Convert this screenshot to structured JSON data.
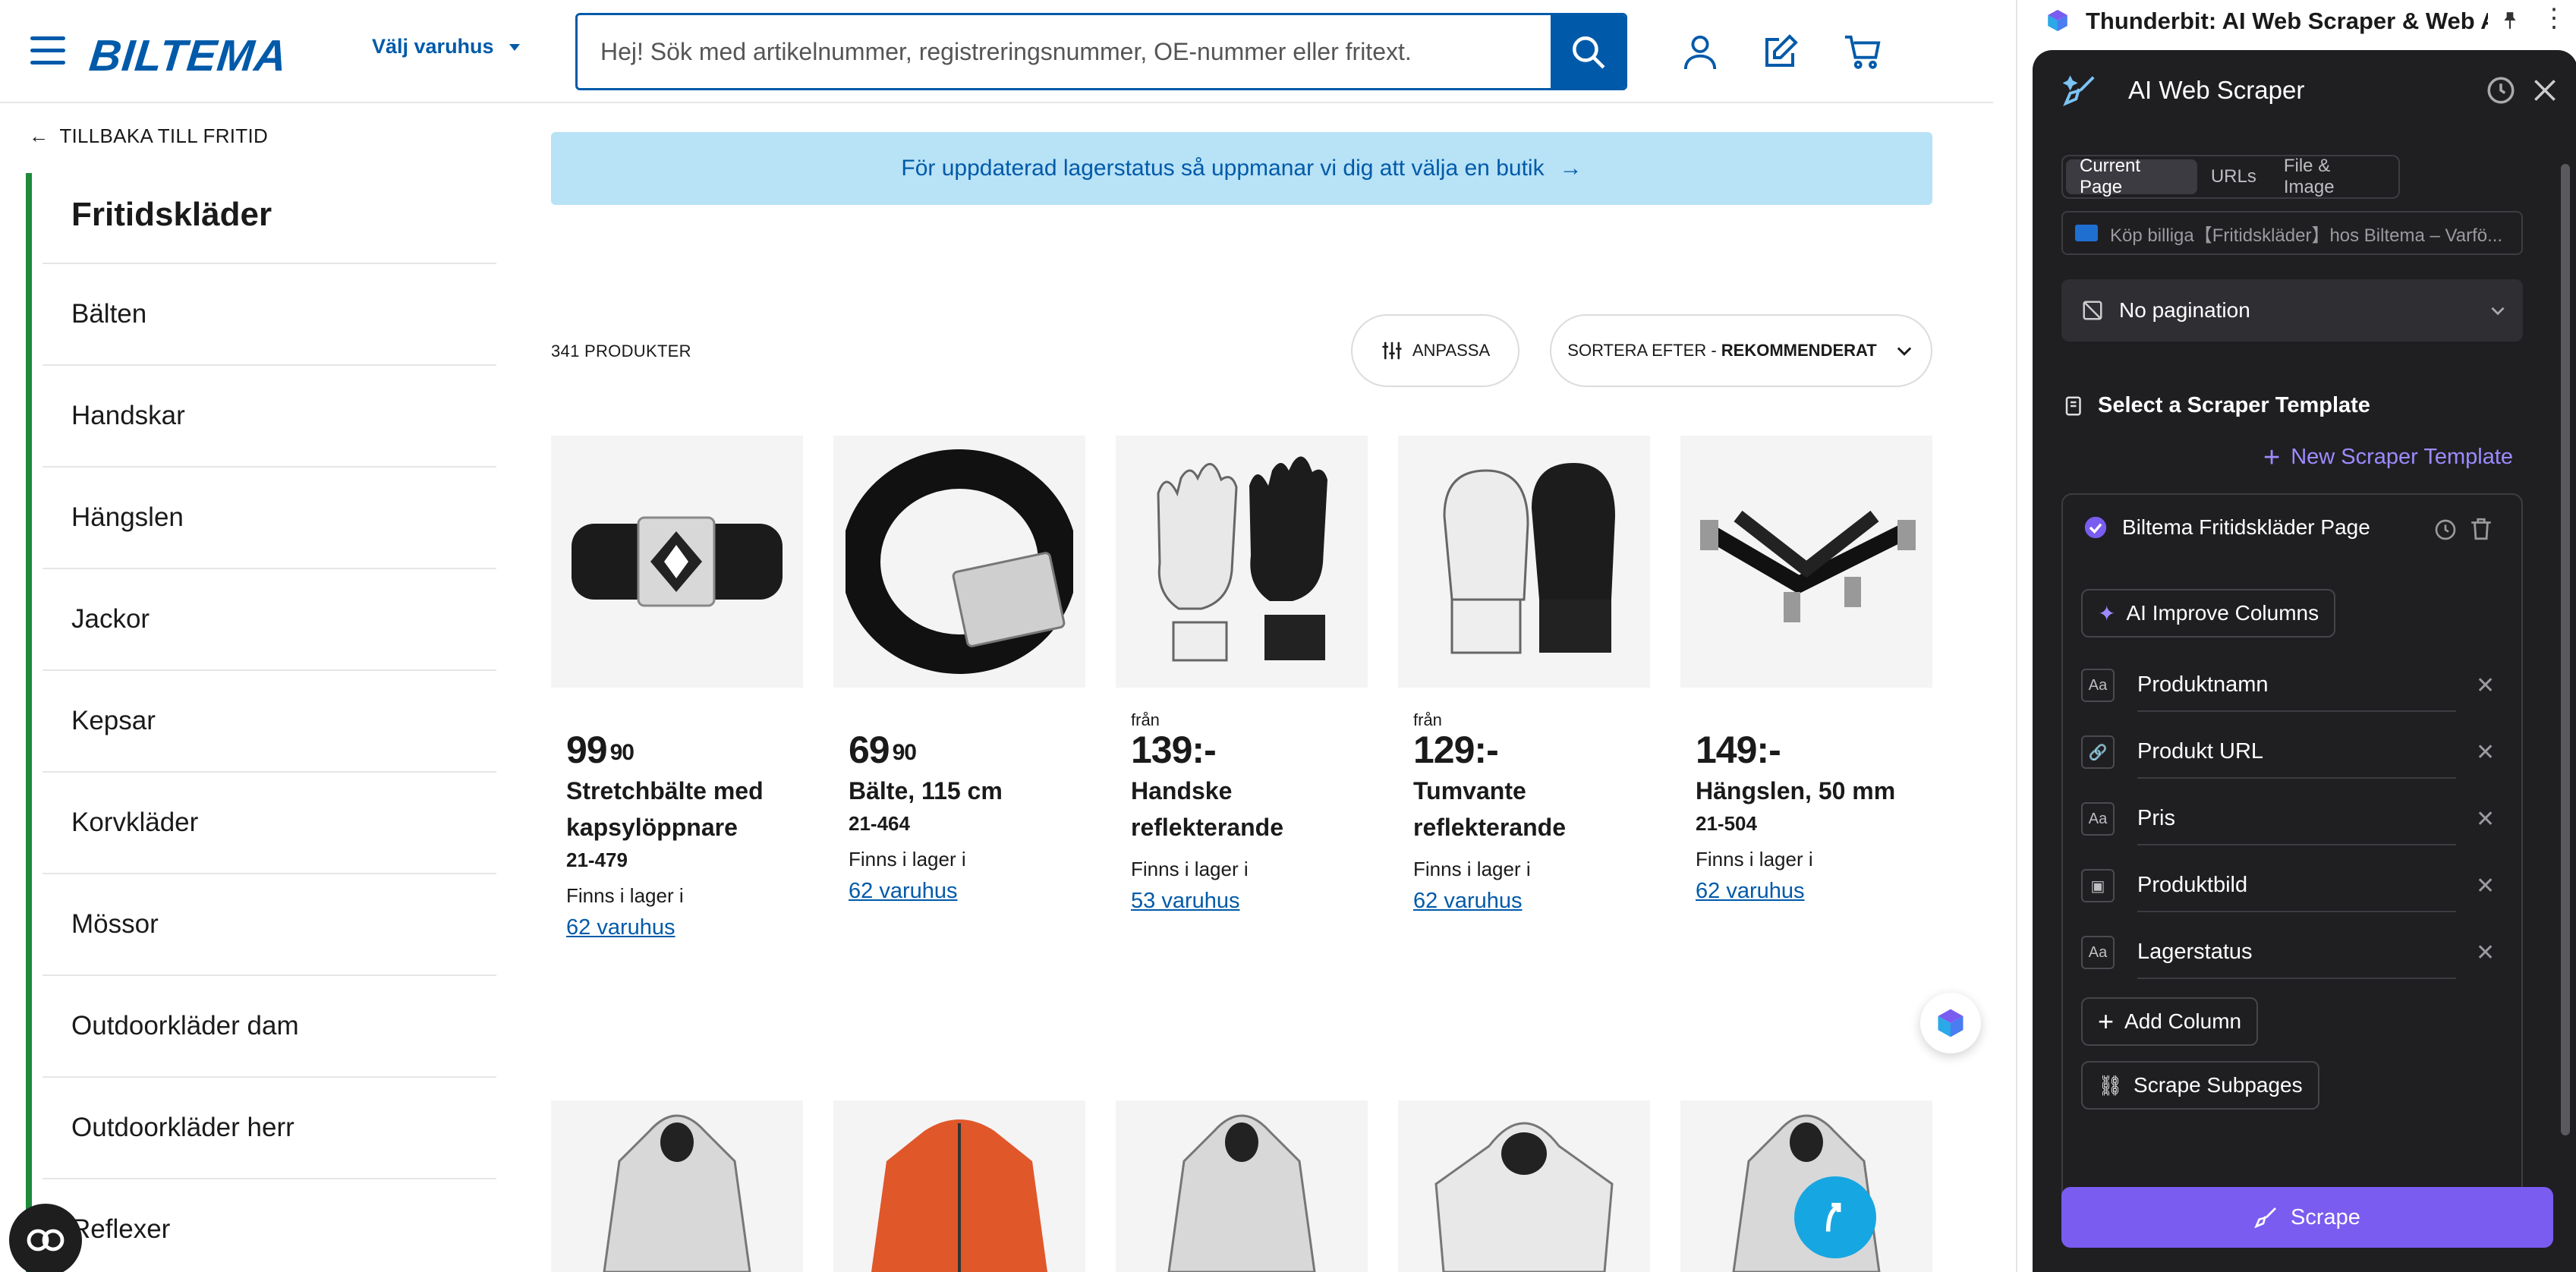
{
  "header": {
    "logo": "BILTEMA",
    "store_select": "Välj varuhus",
    "search_placeholder": "Hej! Sök med artikelnummer, registreringsnummer, OE-nummer eller fritext."
  },
  "sidebar": {
    "back_link": "TILLBAKA TILL FRITID",
    "title": "Fritidskläder",
    "items": [
      "Bälten",
      "Handskar",
      "Hängslen",
      "Jackor",
      "Kepsar",
      "Korvkläder",
      "Mössor",
      "Outdoorkläder dam",
      "Outdoorkläder herr",
      "Reflexer"
    ]
  },
  "main": {
    "banner": "För uppdaterad lagerstatus så uppmanar vi dig att välja en butik",
    "product_count": "341 PRODUKTER",
    "customize_label": "ANPASSA",
    "sort_prefix": "SORTERA EFTER - ",
    "sort_value": "REKOMMENDERAT",
    "products": [
      {
        "from": "",
        "price": "99",
        "cents": "90",
        "name": "Stretchbälte med kapsylöppnare",
        "sku": "21-479",
        "stock": "Finns i lager i",
        "stores": "62 varuhus"
      },
      {
        "from": "",
        "price": "69",
        "cents": "90",
        "name": "Bälte, 115 cm",
        "sku": "21-464",
        "stock": "Finns i lager i",
        "stores": "62 varuhus"
      },
      {
        "from": "från",
        "price": "139:-",
        "cents": "",
        "name": "Handske reflekterande",
        "sku": "",
        "stock": "Finns i lager i",
        "stores": "53 varuhus"
      },
      {
        "from": "från",
        "price": "129:-",
        "cents": "",
        "name": "Tumvante reflekterande",
        "sku": "",
        "stock": "Finns i lager i",
        "stores": "62 varuhus"
      },
      {
        "from": "",
        "price": "149:-",
        "cents": "",
        "name": "Hängslen, 50 mm",
        "sku": "21-504",
        "stock": "Finns i lager i",
        "stores": "62 varuhus"
      }
    ]
  },
  "extension": {
    "window_title": "Thunderbit: AI Web Scraper & Web A...",
    "panel_title": "AI Web Scraper",
    "tabs": [
      "Current Page",
      "URLs",
      "File & Image"
    ],
    "current_url": "Köp billiga【Fritidskläder】hos Biltema – Varfö...",
    "pagination": "No pagination",
    "section_title": "Select a Scraper Template",
    "new_template": "New Scraper Template",
    "template_name": "Biltema Fritidskläder Page",
    "ai_improve": "AI Improve Columns",
    "columns": [
      {
        "icon": "text-icon",
        "name": "Produktnamn"
      },
      {
        "icon": "link-icon",
        "name": "Produkt URL"
      },
      {
        "icon": "text-icon",
        "name": "Pris"
      },
      {
        "icon": "image-icon",
        "name": "Produktbild"
      },
      {
        "icon": "text-icon",
        "name": "Lagerstatus"
      }
    ],
    "add_column": "Add Column",
    "scrape_subpages": "Scrape Subpages",
    "scrape_button": "Scrape",
    "accent": "#7a5cf0"
  },
  "colors": {
    "brand": "#005aa9",
    "sidebar_accent": "#1d8a3c",
    "banner": "#b8e2f6"
  }
}
